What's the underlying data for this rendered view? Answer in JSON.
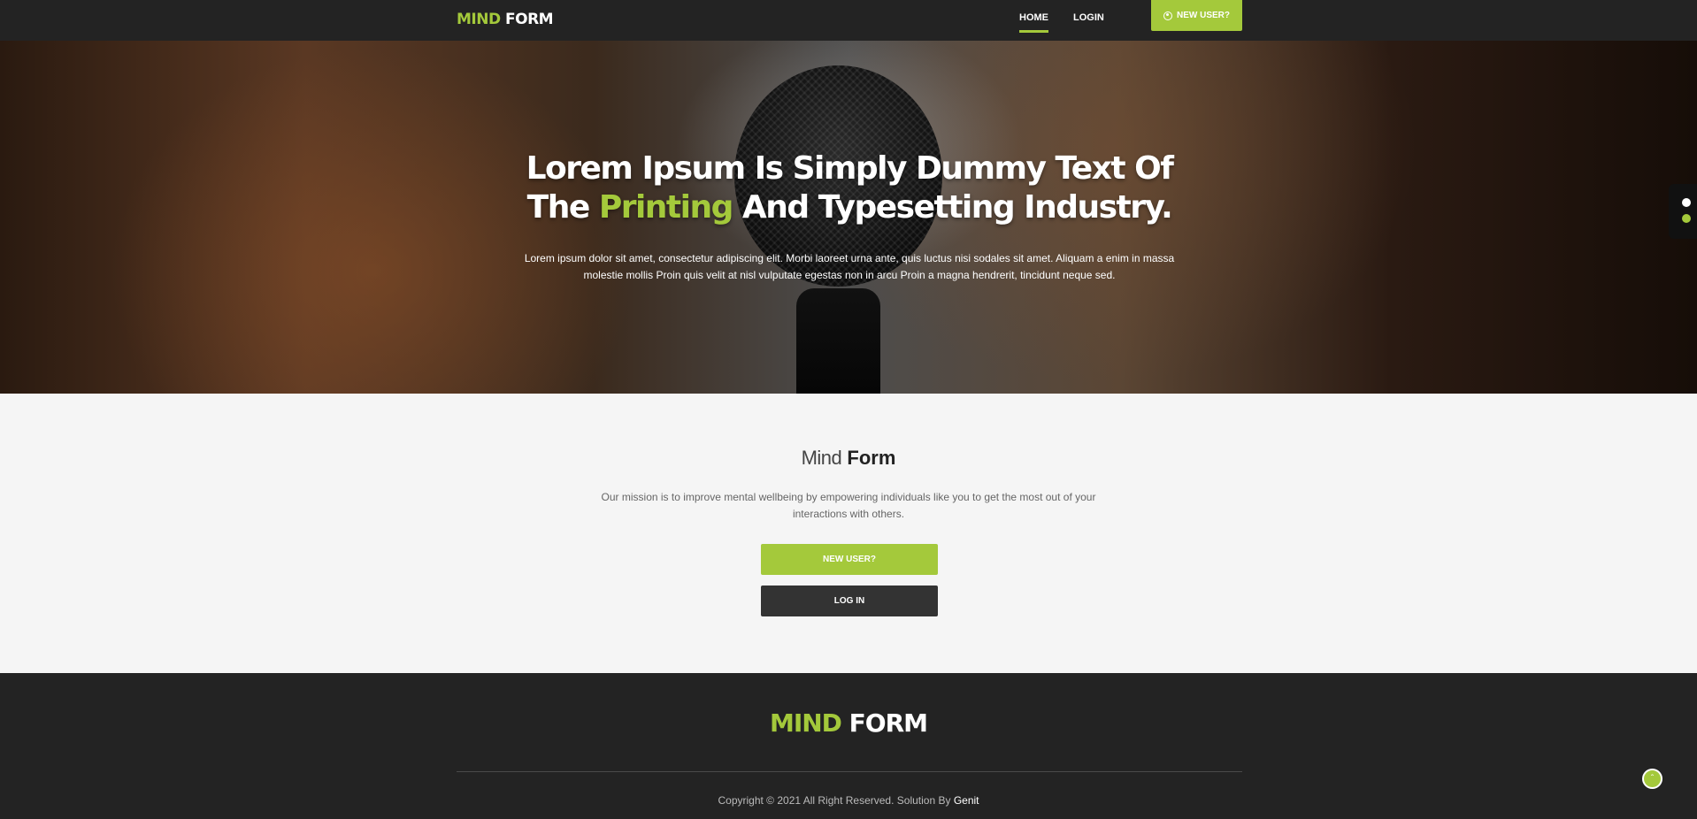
{
  "header": {
    "logo_part1": "MIND",
    "logo_part2": "FORM",
    "nav": {
      "home": "HOME",
      "login": "LOGIN",
      "new_user": "NEW USER?"
    }
  },
  "hero": {
    "title_line1": "Lorem Ipsum Is Simply Dummy Text Of",
    "title_line2_pre": "The ",
    "title_highlight": "Printing",
    "title_line2_post": " And Typesetting Industry.",
    "text": "Lorem ipsum dolor sit amet, consectetur adipiscing elit. Morbi laoreet urna ante, quis luctus nisi sodales sit amet. Aliquam a enim in massa molestie mollis Proin quis velit at nisl vulputate egestas non in arcu Proin a magna hendrerit, tincidunt neque sed."
  },
  "mission": {
    "title_light": "Mind",
    "title_bold": "Form",
    "text": "Our mission is to improve mental wellbeing by empowering individuals like you to get the most out of your interactions with others.",
    "new_user_button": "NEW USER?",
    "login_button": "LOG IN"
  },
  "footer": {
    "logo_part1": "MIND",
    "logo_part2": "FORM",
    "copyright": "Copyright © 2021 All Right Reserved. Solution By ",
    "company": "Genit"
  },
  "colors": {
    "accent": "#a4c93b",
    "dark": "#232323",
    "button_dark": "#333333"
  },
  "icons": {
    "nav_cta": "user-circle-icon",
    "scroll_top": "chevron-up-icon"
  }
}
